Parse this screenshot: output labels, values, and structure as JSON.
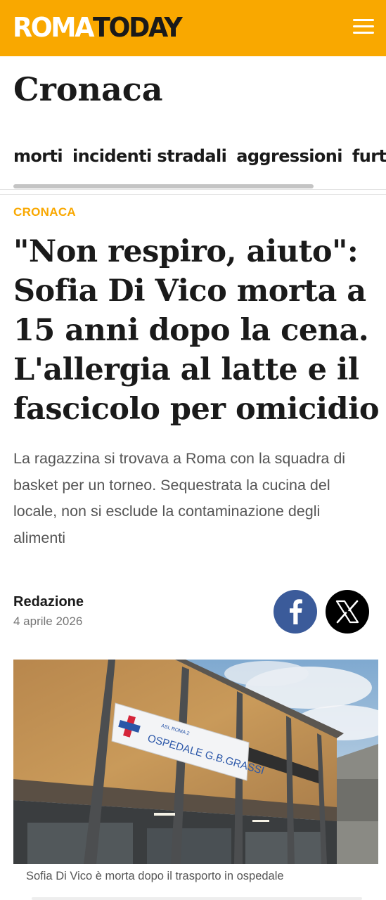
{
  "header": {
    "logo_roma": "ROMA",
    "logo_today": "TODAY",
    "menu_icon": "hamburger-menu-icon",
    "brand_color": "#f9a800"
  },
  "section": {
    "title": "Cronaca",
    "tags": [
      "morti",
      "incidenti stradali",
      "aggressioni",
      "furti"
    ]
  },
  "article": {
    "category": "CRONACA",
    "headline": "\"Non respiro, aiuto\": Sofia Di Vico morta a 15 anni dopo la cena. L'allergia al latte e il fascicolo per omicidio",
    "summary": "La ragazzina si trovava a Roma con la squadra di basket per un torneo. Sequestrata la cucina del locale, non si esclude la contaminazione degli alimenti",
    "author": "Redazione",
    "date": "4 aprile 2026",
    "share": {
      "facebook_icon": "facebook-icon",
      "x_icon": "x-twitter-icon",
      "facebook_color": "#3b5b9a",
      "x_color": "#000000"
    },
    "image": {
      "sign_line1": "ASL ROMA 2",
      "sign_line2": "OSPEDALE G.B.GRASSI"
    },
    "caption": "Sofia Di Vico è morta dopo il trasporto in ospedale"
  }
}
